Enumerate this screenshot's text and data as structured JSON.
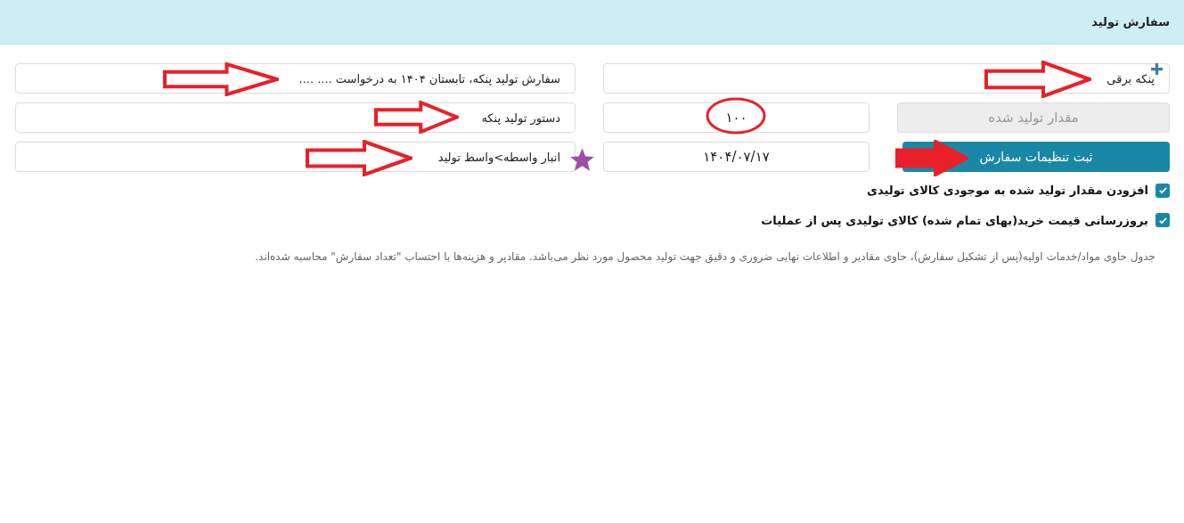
{
  "header": {
    "title": "سفارش تولید"
  },
  "product_field": {
    "value": "پنکه برقی"
  },
  "order_title_field": {
    "value": "سفارش تولید پنکه، تابستان ۱۴۰۴ به درخواست .... ...."
  },
  "produced_quantity_field": {
    "placeholder": "مقدار تولید شده",
    "disabled": true
  },
  "quantity_field": {
    "value": "۱۰۰"
  },
  "recipe_field": {
    "value": "دستور تولید پنکه"
  },
  "save_button": {
    "label": "ثبت تنظیمات سفارش"
  },
  "date_field": {
    "value": "۱۴۰۴/۰۷/۱۷"
  },
  "warehouse_field": {
    "value": "انبار واسطه>واسط تولید"
  },
  "checkboxes": [
    {
      "label": "افزودن مقدار تولید شده به موجودی کالای تولیدی",
      "checked": true
    },
    {
      "label": "بروزرسانی قیمت خرید(بهای تمام شده) کالای تولیدی پس از عملیات",
      "checked": true
    }
  ],
  "note": "جدول حاوی مواد/خدمات اولیه(پس از تشکیل سفارش)، حاوی مقادیر و اطلاعات نهایی ضروری و دقیق جهت تولید محصول مورد نظر می‌باشد. مقادیر و هزینه‌ها با احتساب \"تعداد سفارش\" محاسبه شده‌اند."
}
